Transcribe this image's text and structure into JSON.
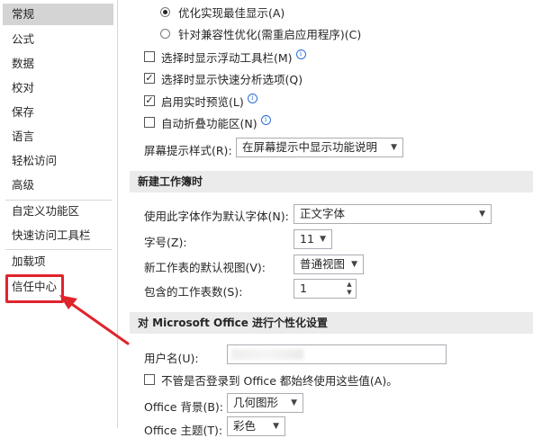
{
  "sidebar": {
    "items": [
      {
        "label": "常规",
        "selected": true
      },
      {
        "label": "公式"
      },
      {
        "label": "数据"
      },
      {
        "label": "校对"
      },
      {
        "label": "保存"
      },
      {
        "label": "语言"
      },
      {
        "label": "轻松访问"
      },
      {
        "label": "高级"
      },
      {
        "label": "自定义功能区"
      },
      {
        "label": "快速访问工具栏"
      },
      {
        "label": "加载项"
      },
      {
        "label": "信任中心"
      }
    ]
  },
  "display": {
    "radio_best": "优化实现最佳显示(A)",
    "radio_compat": "针对兼容性优化(需重启应用程序)(C)",
    "cb_float_toolbar": "选择时显示浮动工具栏(M)",
    "cb_quick_analysis": "选择时显示快速分析选项(Q)",
    "cb_live_preview": "启用实时预览(L)",
    "cb_collapse_ribbon": "自动折叠功能区(N)",
    "screentip_label": "屏幕提示样式(R):",
    "screentip_value": "在屏幕提示中显示功能说明"
  },
  "new_workbook": {
    "title": "新建工作簿时",
    "font_label": "使用此字体作为默认字体(N):",
    "font_value": "正文字体",
    "size_label": "字号(Z):",
    "size_value": "11",
    "view_label": "新工作表的默认视图(V):",
    "view_value": "普通视图",
    "sheets_label": "包含的工作表数(S):",
    "sheets_value": "1"
  },
  "personalize": {
    "title": "对 Microsoft Office 进行个性化设置",
    "username_label": "用户名(U):",
    "always_use": "不管是否登录到 Office 都始终使用这些值(A)。",
    "background_label": "Office 背景(B):",
    "background_value": "几何图形",
    "theme_label": "Office 主题(T):",
    "theme_value": "彩色"
  },
  "icons": {
    "info": "i",
    "check": "✓",
    "chevron": "▼",
    "spin_up": "▲",
    "spin_down": "▼"
  },
  "colors": {
    "highlight": "#e0242c",
    "selected_bg": "#d4d4d4",
    "section_bg": "#ebebeb"
  }
}
